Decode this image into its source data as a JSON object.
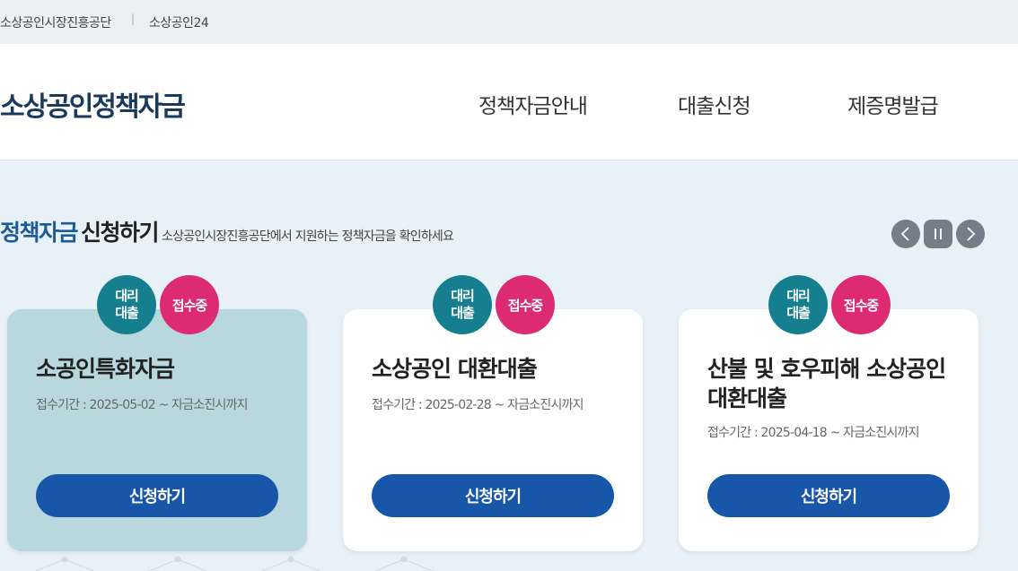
{
  "topbar": {
    "org_link": "소상공인시장진흥공단",
    "separator": "|",
    "portal_link": "소상공인24"
  },
  "header": {
    "logo": "소상공인정책자금",
    "nav": [
      "정책자금안내",
      "대출신청",
      "제증명발급"
    ]
  },
  "section": {
    "title_highlight": "정책자금",
    "title_rest": "신청하기",
    "description": "소상공인시장진흥공단에서 지원하는 정책자금을 확인하세요"
  },
  "slider_controls": {
    "prev_icon": "chevron-left-icon",
    "pause_icon": "pause-icon",
    "next_icon": "chevron-right-icon"
  },
  "cards": [
    {
      "badge_type": "대리\n대출",
      "badge_status": "접수중",
      "title": "소공인특화자금",
      "period": "접수기간 : 2025-05-02 ~ 자금소진시까지",
      "button": "신청하기"
    },
    {
      "badge_type": "대리\n대출",
      "badge_status": "접수중",
      "title": "소상공인 대환대출",
      "period": "접수기간 : 2025-02-28 ~ 자금소진시까지",
      "button": "신청하기"
    },
    {
      "badge_type": "대리\n대출",
      "badge_status": "접수중",
      "title": "산불 및 호우피해 소상공인 대환대출",
      "period": "접수기간 : 2025-04-18 ~ 자금소진시까지",
      "button": "신청하기"
    }
  ],
  "colors": {
    "brand_blue": "#1756a9",
    "title_blue": "#1d5b96",
    "teal": "#157f8f",
    "pink": "#dc2a73",
    "active_card": "#b9d8de"
  }
}
